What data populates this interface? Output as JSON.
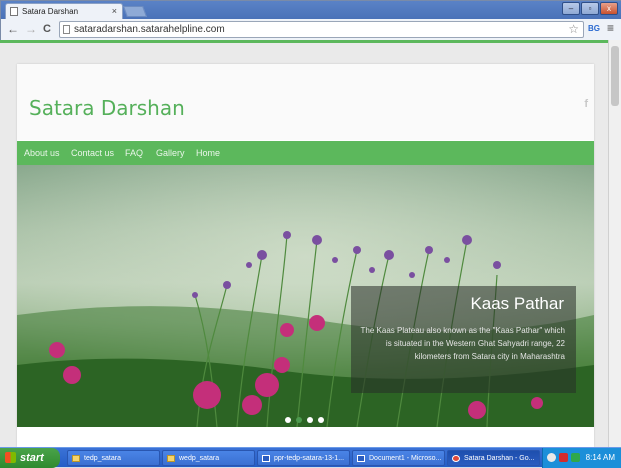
{
  "browser": {
    "tab_title": "Satara Darshan",
    "tab_close": "×",
    "url": "sataradarshan.satarahelpline.com",
    "back": "←",
    "forward": "→",
    "reload": "C",
    "window_minimize": "–",
    "window_restore": "▫",
    "window_close": "x",
    "extension": "BG",
    "menu": "≡",
    "star": "☆"
  },
  "site": {
    "title": "Satara Darshan",
    "facebook": "f",
    "nav": [
      "About us",
      "Contact us",
      "FAQ",
      "Gallery",
      "Home"
    ],
    "slide": {
      "heading": "Kaas Pathar",
      "text": "The Kaas Plateau also known as the \"Kaas Pathar\" which is situated in the Western Ghat Sahyadri range, 22 kilometers from Satara city in Maharashtra"
    },
    "slide_count": 4,
    "active_slide": 2
  },
  "taskbar": {
    "start": "start",
    "tasks": [
      "tedp_satara",
      "wedp_satara",
      "ppr-tedp-satara-13-1...",
      "Document1 - Microso...",
      "Satara Darshan - Go..."
    ],
    "clock": "8:14 AM"
  },
  "colors": {
    "brand_green": "#5cb85c",
    "title_green": "#55b05a"
  }
}
